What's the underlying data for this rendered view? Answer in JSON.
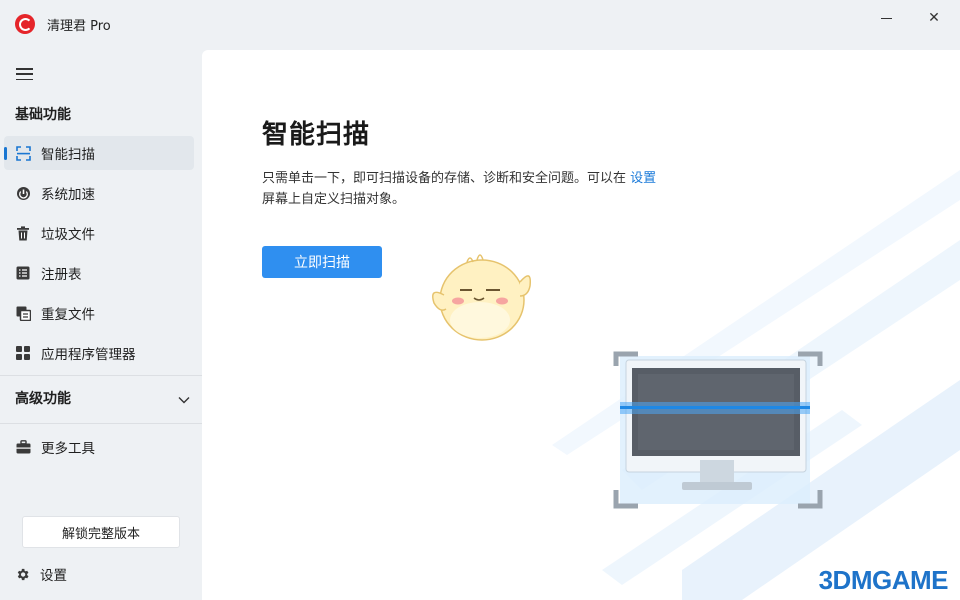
{
  "window": {
    "title": "清理君 Pro",
    "minimize": "",
    "close": "✕"
  },
  "sidebar": {
    "basic_section": "基础功能",
    "items": [
      {
        "label": "智能扫描",
        "icon": "scan-icon"
      },
      {
        "label": "系统加速",
        "icon": "speed-icon"
      },
      {
        "label": "垃圾文件",
        "icon": "trash-icon"
      },
      {
        "label": "注册表",
        "icon": "registry-icon"
      },
      {
        "label": "重复文件",
        "icon": "duplicate-icon"
      },
      {
        "label": "应用程序管理器",
        "icon": "apps-icon"
      }
    ],
    "advanced_section": "高级功能",
    "more_tools": "更多工具",
    "unlock_button": "解锁完整版本",
    "settings": "设置"
  },
  "main": {
    "title": "智能扫描",
    "description_prefix": "只需单击一下，即可扫描设备的存储、诊断和安全问题。可以在",
    "description_link": "设置",
    "description_suffix": "屏幕上自定义扫描对象。",
    "scan_button": "立即扫描"
  },
  "watermark": "3DMGAME",
  "colors": {
    "accent": "#2f8ff0",
    "link": "#1a7ad9",
    "logo": "#e5252a",
    "active_indicator": "#1976d2"
  }
}
